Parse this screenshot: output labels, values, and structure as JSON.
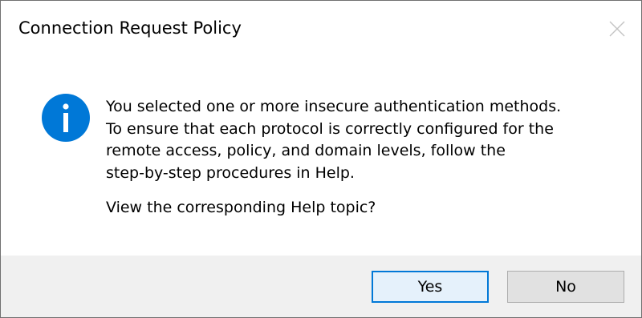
{
  "dialog": {
    "title": "Connection Request Policy",
    "icon": "info-icon",
    "close_icon": "close-icon",
    "message_lines": [
      "You selected one or more insecure authentication methods.",
      "To ensure that each protocol is correctly configured for the",
      "remote access, policy, and domain levels, follow the",
      "step-by-step procedures in Help."
    ],
    "question": "View the corresponding Help topic?",
    "buttons": {
      "yes": "Yes",
      "no": "No"
    },
    "colors": {
      "info_icon": "#0078d7",
      "default_button_border": "#0078d7",
      "footer_background": "#f0f0f0"
    }
  }
}
